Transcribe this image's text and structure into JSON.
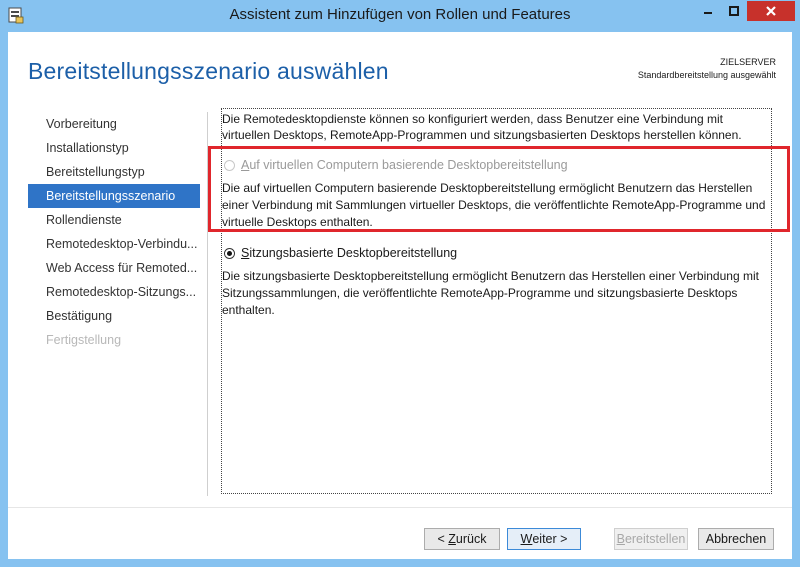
{
  "window": {
    "title": "Assistent zum Hinzufügen von Rollen und Features",
    "controls": {
      "minimize": "minimize-icon",
      "maximize": "maximize-icon",
      "close": "close-icon"
    },
    "colors": {
      "frame": "#86c2f0",
      "close": "#c7312b",
      "accent": "#2f74c7",
      "highlight": "#e0262c"
    }
  },
  "header": {
    "title": "Bereitstellungsszenario auswählen",
    "server_label": "ZIELSERVER",
    "server_value": "Standardbereitstellung ausgewählt"
  },
  "nav": {
    "items": [
      {
        "label": "Vorbereitung",
        "state": "normal"
      },
      {
        "label": "Installationstyp",
        "state": "normal"
      },
      {
        "label": "Bereitstellungstyp",
        "state": "normal"
      },
      {
        "label": "Bereitstellungsszenario",
        "state": "active"
      },
      {
        "label": "Rollendienste",
        "state": "normal"
      },
      {
        "label": "Remotedesktop-Verbindu...",
        "state": "normal"
      },
      {
        "label": "Web Access für Remoted...",
        "state": "normal"
      },
      {
        "label": "Remotedesktop-Sitzungs...",
        "state": "normal"
      },
      {
        "label": "Bestätigung",
        "state": "normal"
      },
      {
        "label": "Fertigstellung",
        "state": "disabled"
      }
    ]
  },
  "content": {
    "intro": "Die Remotedesktopdienste können so konfiguriert werden, dass Benutzer eine Verbindung mit virtuellen Desktops, RemoteApp-Programmen und sitzungsbasierten Desktops herstellen können.",
    "options": [
      {
        "label_prefix": "",
        "label_accel": "A",
        "label_rest": "uf virtuellen Computern basierende Desktopbereitstellung",
        "description": "Die auf virtuellen Computern basierende Desktopbereitstellung ermöglicht Benutzern das Herstellen einer Verbindung mit Sammlungen virtueller Desktops, die veröffentlichte RemoteApp-Programme und virtuelle Desktops enthalten.",
        "selected": false,
        "disabled": true
      },
      {
        "label_prefix": "",
        "label_accel": "S",
        "label_rest": "itzungsbasierte Desktopbereitstellung",
        "description": "Die sitzungsbasierte Desktopbereitstellung ermöglicht Benutzern das Herstellen einer Verbindung mit Sitzungssammlungen, die veröffentlichte RemoteApp-Programme und sitzungsbasierte Desktops enthalten.",
        "selected": true,
        "disabled": false
      }
    ]
  },
  "buttons": {
    "back_prefix": "< ",
    "back_accel": "Z",
    "back_rest": "urück",
    "next_accel": "W",
    "next_rest": "eiter >",
    "deploy_accel": "B",
    "deploy_rest": "ereitstellen",
    "cancel": "Abbrechen"
  }
}
